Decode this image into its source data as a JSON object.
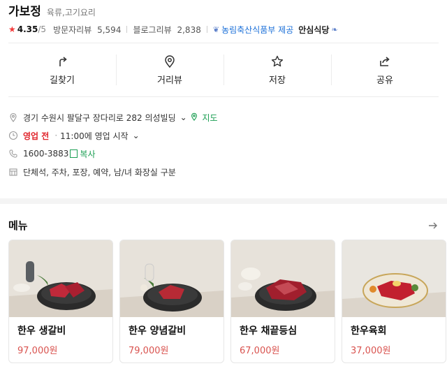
{
  "place": {
    "name": "가보정",
    "category": "육류,고기요리",
    "rating": "4.35",
    "rating_max": "/5",
    "visitor_reviews_label": "방문자리뷰",
    "visitor_reviews_count": "5,594",
    "blog_reviews_label": "블로그리뷰",
    "blog_reviews_count": "2,838",
    "certification": "농림축산식품부 제공",
    "certification_badge": "안심식당"
  },
  "actions": [
    {
      "label": "길찾기",
      "icon": "directions-icon"
    },
    {
      "label": "거리뷰",
      "icon": "location-pin-icon"
    },
    {
      "label": "저장",
      "icon": "star-icon"
    },
    {
      "label": "공유",
      "icon": "share-icon"
    }
  ],
  "info": {
    "address": "경기 수원시 팔달구 장다리로 282 의성빌딩",
    "map_label": "지도",
    "status": "영업 전",
    "hours": "11:00에 영업 시작",
    "phone": "1600-3883",
    "copy_label": "복사",
    "amenities": "단체석, 주차, 포장, 예약, 남/녀 화장실 구분"
  },
  "menu": {
    "title": "메뉴",
    "items": [
      {
        "name": "한우 생갈비",
        "price": "97,000원"
      },
      {
        "name": "한우 양념갈비",
        "price": "79,000원"
      },
      {
        "name": "한우 채끝등심",
        "price": "67,000원"
      },
      {
        "name": "한우육회",
        "price": "37,000원"
      }
    ]
  },
  "colors": {
    "accent_green": "#1a9e52",
    "closed_red": "#e0242b",
    "price_red": "#d9534f",
    "cert_blue": "#1a6fd8"
  }
}
